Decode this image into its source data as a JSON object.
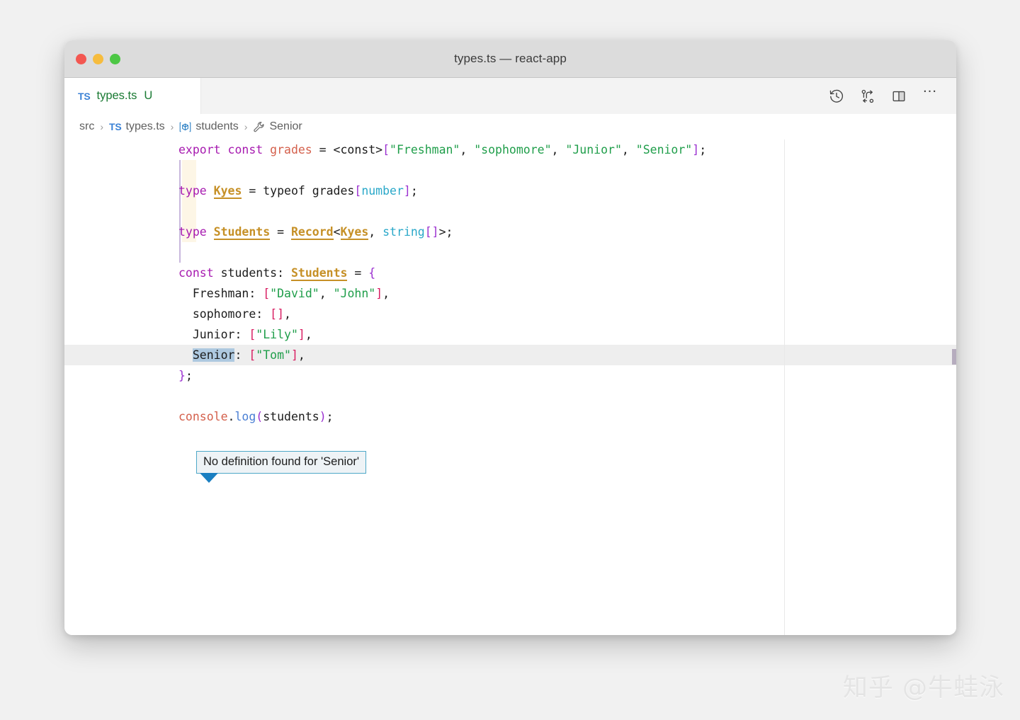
{
  "window": {
    "title": "types.ts — react-app",
    "traffic_lights": [
      {
        "name": "close",
        "color": "#f35751"
      },
      {
        "name": "minimize",
        "color": "#f6bc3e"
      },
      {
        "name": "maximize",
        "color": "#4dc745"
      }
    ]
  },
  "tabbar": {
    "tab": {
      "icon_label": "TS",
      "filename": "types.ts",
      "status_badge": "U"
    },
    "actions": [
      {
        "name": "timeline-history-icon",
        "label": "Open Changes / History"
      },
      {
        "name": "source-control-compare-icon",
        "label": "Compare Changes"
      },
      {
        "name": "split-editor-icon",
        "label": "Split Editor"
      },
      {
        "name": "more-actions-icon",
        "label": "…"
      }
    ]
  },
  "breadcrumb": {
    "items": [
      {
        "label": "src",
        "icon": "none"
      },
      {
        "label": "types.ts",
        "icon": "ts-file-icon"
      },
      {
        "label": "students",
        "icon": "variable-icon"
      },
      {
        "label": "Senior",
        "icon": "property-wrench-icon"
      }
    ],
    "separator": "›"
  },
  "code": {
    "lines": [
      [
        {
          "t": "export const ",
          "c": "kw"
        },
        {
          "t": "grades",
          "c": "var"
        },
        {
          "t": " = <const>",
          "c": "op"
        },
        {
          "t": "[",
          "c": "brk"
        },
        {
          "t": "\"Freshman\"",
          "c": "str"
        },
        {
          "t": ", ",
          "c": "op"
        },
        {
          "t": "\"sophomore\"",
          "c": "str"
        },
        {
          "t": ", ",
          "c": "op"
        },
        {
          "t": "\"Junior\"",
          "c": "str"
        },
        {
          "t": ", ",
          "c": "op"
        },
        {
          "t": "\"Senior\"",
          "c": "str"
        },
        {
          "t": "]",
          "c": "brk"
        },
        {
          "t": ";",
          "c": "op"
        }
      ],
      [],
      [
        {
          "t": "type ",
          "c": "kw"
        },
        {
          "t": "Kyes",
          "c": "typ"
        },
        {
          "t": " = typeof grades",
          "c": "op"
        },
        {
          "t": "[",
          "c": "brk"
        },
        {
          "t": "number",
          "c": "prim"
        },
        {
          "t": "]",
          "c": "brk"
        },
        {
          "t": ";",
          "c": "op"
        }
      ],
      [],
      [
        {
          "t": "type ",
          "c": "kw"
        },
        {
          "t": "Students",
          "c": "typ"
        },
        {
          "t": " = ",
          "c": "op"
        },
        {
          "t": "Record",
          "c": "typ"
        },
        {
          "t": "<",
          "c": "op"
        },
        {
          "t": "Kyes",
          "c": "typ"
        },
        {
          "t": ", ",
          "c": "op"
        },
        {
          "t": "string",
          "c": "prim"
        },
        {
          "t": "[]",
          "c": "brk"
        },
        {
          "t": ">;",
          "c": "op"
        }
      ],
      [],
      [
        {
          "t": "const ",
          "c": "kw"
        },
        {
          "t": "students",
          "c": "op"
        },
        {
          "t": ": ",
          "c": "op"
        },
        {
          "t": "Students",
          "c": "typ"
        },
        {
          "t": " = ",
          "c": "op"
        },
        {
          "t": "{",
          "c": "brk"
        }
      ],
      [
        {
          "t": "  Freshman",
          "c": "prop"
        },
        {
          "t": ": ",
          "c": "op"
        },
        {
          "t": "[",
          "c": "brk2"
        },
        {
          "t": "\"David\"",
          "c": "str"
        },
        {
          "t": ", ",
          "c": "op"
        },
        {
          "t": "\"John\"",
          "c": "str"
        },
        {
          "t": "]",
          "c": "brk2"
        },
        {
          "t": ",",
          "c": "op"
        }
      ],
      [
        {
          "t": "  sophomore",
          "c": "prop"
        },
        {
          "t": ": ",
          "c": "op"
        },
        {
          "t": "[]",
          "c": "brk2"
        },
        {
          "t": ",",
          "c": "op"
        }
      ],
      [
        {
          "t": "  Junior",
          "c": "prop"
        },
        {
          "t": ": ",
          "c": "op"
        },
        {
          "t": "[",
          "c": "brk2"
        },
        {
          "t": "\"Lily\"",
          "c": "str"
        },
        {
          "t": "]",
          "c": "brk2"
        },
        {
          "t": ",",
          "c": "op"
        }
      ],
      [
        {
          "t": "  ",
          "c": "op"
        },
        {
          "t": "Senior",
          "c": "prop sel"
        },
        {
          "t": ": ",
          "c": "op"
        },
        {
          "t": "[",
          "c": "brk2"
        },
        {
          "t": "\"Tom\"",
          "c": "str"
        },
        {
          "t": "]",
          "c": "brk2"
        },
        {
          "t": ",",
          "c": "op"
        }
      ],
      [
        {
          "t": "}",
          "c": "brk"
        },
        {
          "t": ";",
          "c": "op"
        }
      ],
      [],
      [
        {
          "t": "console",
          "c": "var"
        },
        {
          "t": ".",
          "c": "op"
        },
        {
          "t": "log",
          "c": "fn"
        },
        {
          "t": "(",
          "c": "brk"
        },
        {
          "t": "students",
          "c": "op"
        },
        {
          "t": ")",
          "c": "brk"
        },
        {
          "t": ";",
          "c": "op"
        }
      ]
    ],
    "current_line_index": 10
  },
  "tooltip": {
    "message": "No definition found for 'Senior'",
    "border_color": "#4ea8c8",
    "background_color": "#eef3f6",
    "arrow_color": "#1a7fc1"
  },
  "watermark": {
    "text": "知乎 @牛蛙泳"
  },
  "colors": {
    "keyword": "#a71bb0",
    "variable": "#d4604c",
    "string": "#1f9e4a",
    "type": "#c69026",
    "primitive": "#2aa8c9",
    "bracket": "#9b30d0",
    "bracket_array": "#d81b60",
    "function": "#4a7fd4",
    "selection": "#aec9e0",
    "tab_modified": "#1a7a33",
    "ts_blue": "#3b82d6"
  }
}
